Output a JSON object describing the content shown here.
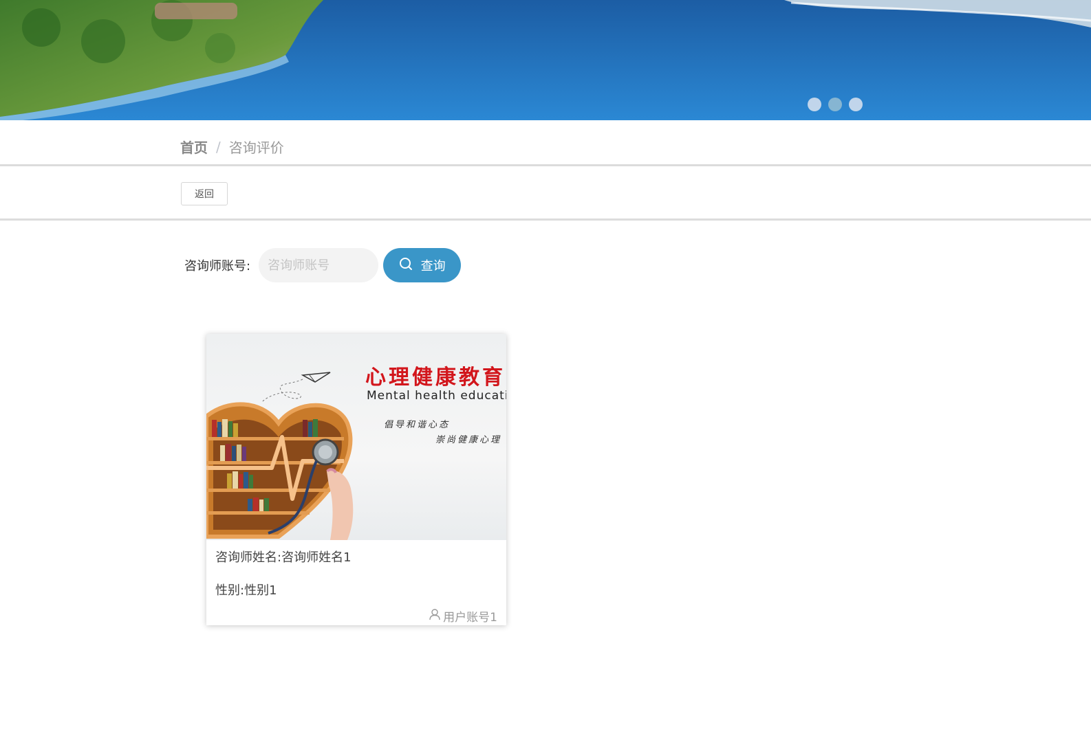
{
  "banner": {
    "indicator_dots": 3,
    "active_dot": 1
  },
  "breadcrumb": {
    "home": "首页",
    "separator": "/",
    "current": "咨询评价"
  },
  "toolbar": {
    "back_label": "返回"
  },
  "search": {
    "label": "咨询师账号:",
    "placeholder": "咨询师账号",
    "value": "",
    "button_label": "查询",
    "button_icon": "search-icon"
  },
  "card": {
    "image": {
      "title_cn": "心理健康教育",
      "title_en": "Mental health education",
      "slogan_1": "倡导和谐心态",
      "slogan_2": "崇尚健康心理"
    },
    "name_line": "咨询师姓名:咨询师姓名1",
    "gender_line": "性别:性别1",
    "user_icon": "user-icon",
    "user_account": "用户账号1"
  },
  "colors": {
    "accent": "#3a96c8",
    "breadcrumb_home": "#888888",
    "breadcrumb_current": "#999999",
    "divider": "#dcdcdc"
  }
}
